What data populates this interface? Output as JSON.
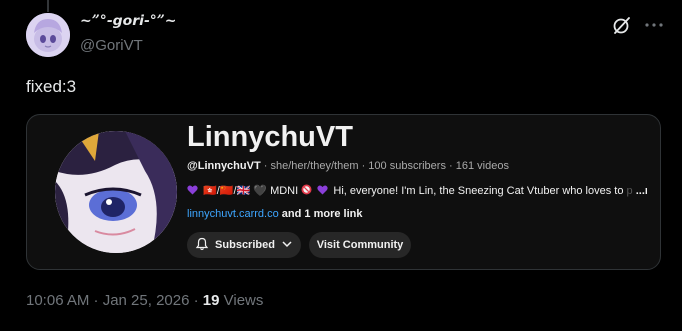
{
  "author": {
    "display_name": "~”°-𝙜𝙤𝙧𝙞-°”~",
    "handle": "@GoriVT"
  },
  "post": {
    "text": "fixed:3"
  },
  "youtube_card": {
    "channel_name": "LinnychuVT",
    "handle": "@LinnychuVT",
    "pronouns": "· she/her/they/them",
    "subscribers": "· 100 subscribers",
    "videos": "· 161 videos",
    "description_start": "🇭🇰/🇨🇳/🇬🇧 🖤 MDNI",
    "description_rest": "Hi, everyone! I'm Lin, the Sneezing Cat Vtuber who loves to",
    "description_faded": "p",
    "more_label": "...more",
    "link_text": "linnychuvt.carrd.co",
    "more_links": "and 1 more link",
    "subscribed_label": "Subscribed",
    "visit_label": "Visit Community"
  },
  "footer": {
    "time": "10:06 AM · Jan 25, 2026 · ",
    "views_count": "19",
    "views_label": " Views"
  },
  "colors": {
    "background": "#000000",
    "card_bg": "#0f0f0f",
    "link": "#3ea6ff",
    "muted": "#71767b",
    "heart": "#8b3fd9"
  },
  "icons": [
    "grok-icon",
    "more-dots-icon",
    "purple-heart-icon",
    "no-entry-icon",
    "bell-icon",
    "chevron-down-icon"
  ]
}
